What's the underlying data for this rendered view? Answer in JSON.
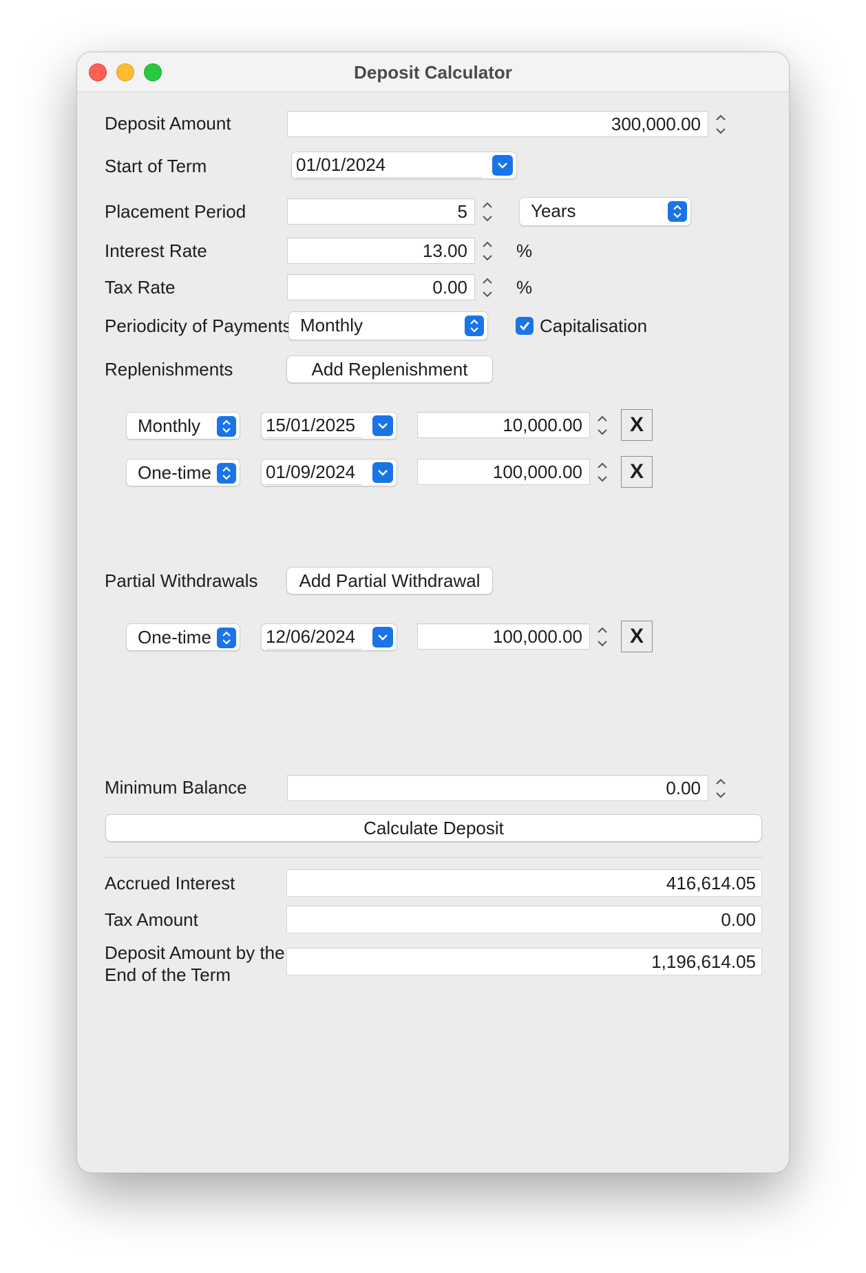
{
  "window": {
    "title": "Deposit Calculator"
  },
  "labels": {
    "deposit_amount": "Deposit Amount",
    "start_of_term": "Start of Term",
    "placement_period": "Placement Period",
    "interest_rate": "Interest Rate",
    "tax_rate": "Tax Rate",
    "periodicity": "Periodicity of Payments",
    "replenishments": "Replenishments",
    "partial_withdrawals": "Partial Withdrawals",
    "minimum_balance": "Minimum Balance",
    "accrued_interest": "Accrued Interest",
    "tax_amount": "Tax Amount",
    "deposit_end_line1": "Deposit Amount by the",
    "deposit_end_line2": "End of the Term"
  },
  "inputs": {
    "deposit_amount": "300,000.00",
    "start_of_term": "01/01/2024",
    "placement_period": "5",
    "period_unit": "Years",
    "interest_rate": "13.00",
    "tax_rate": "0.00",
    "percent_symbol": "%",
    "periodicity": "Monthly",
    "capitalisation_label": "Capitalisation",
    "capitalisation_checked": true,
    "minimum_balance": "0.00"
  },
  "buttons": {
    "add_replenishment": "Add Replenishment",
    "add_partial_withdrawal": "Add Partial Withdrawal",
    "calculate": "Calculate Deposit",
    "remove": "X"
  },
  "replenishments": [
    {
      "type": "Monthly",
      "date": "15/01/2025",
      "amount": "10,000.00"
    },
    {
      "type": "One-time",
      "date": "01/09/2024",
      "amount": "100,000.00"
    }
  ],
  "withdrawals": [
    {
      "type": "One-time",
      "date": "12/06/2024",
      "amount": "100,000.00"
    }
  ],
  "results": {
    "accrued_interest": "416,614.05",
    "tax_amount": "0.00",
    "deposit_end": "1,196,614.05"
  },
  "colors": {
    "accent": "#1a74e8",
    "close": "#fe5f57",
    "minimize": "#febc2e",
    "maximize": "#28c840"
  }
}
